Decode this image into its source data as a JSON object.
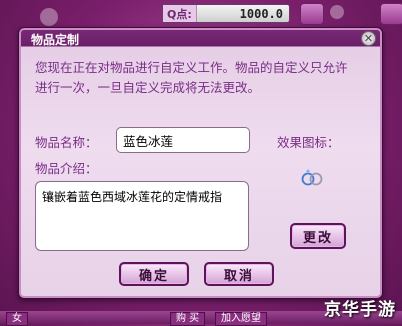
{
  "background": {
    "qpoints_label": "Q点:",
    "qpoints_value": "1000.0",
    "left_tab_label": "女",
    "bottom_buttons": [
      "购 买",
      "加入愿望"
    ]
  },
  "dialog": {
    "title": "物品定制",
    "close_icon": "x-icon",
    "description": "您现在正在对物品进行自定义工作。物品的自定义只允许进行一次，一旦自定义完成将无法更改。",
    "name_label": "物品名称：",
    "name_value": "蓝色冰莲",
    "intro_label": "物品介绍：",
    "intro_value": "镶嵌着蓝色西域冰莲花的定情戒指",
    "effect_label": "效果图标：",
    "effect_icon": "ring-icon",
    "change_button": "更改",
    "ok_button": "确定",
    "cancel_button": "取消"
  },
  "watermark": "京华手游",
  "colors": {
    "background": "#7a1f6b",
    "dialog_panel": "#efdcef",
    "label_text": "#7a2d86",
    "title_bar": "#6b1f69"
  }
}
